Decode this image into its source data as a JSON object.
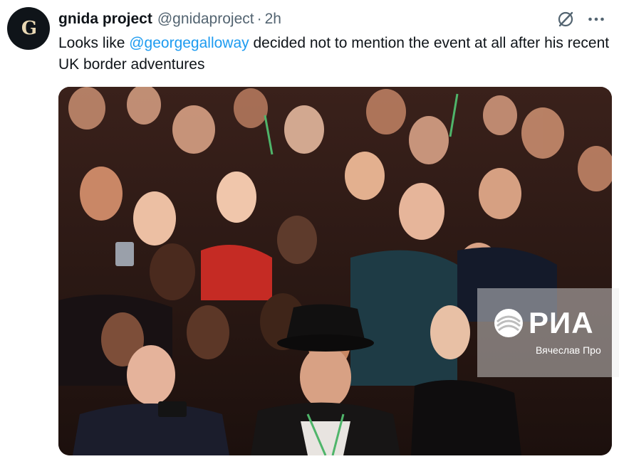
{
  "author": {
    "name": "gnida project",
    "handle": "@gnidaproject",
    "separator": "·",
    "time": "2h",
    "avatar_icon": "gnida-logo-icon",
    "avatar_letters": "G"
  },
  "tweet": {
    "text_before": "Looks like ",
    "mention": "@georgegalloway",
    "text_after": " decided not to mention the event at all after his recent UK border adventures"
  },
  "header_icons": [
    "grok-icon",
    "more-options-icon"
  ],
  "media": {
    "type": "photo",
    "watermark_logo": "РИА",
    "watermark_credit": "Вячеслав Про"
  },
  "colors": {
    "accent": "#1d9bf0",
    "text": "#0f1419",
    "secondary": "#536471"
  }
}
